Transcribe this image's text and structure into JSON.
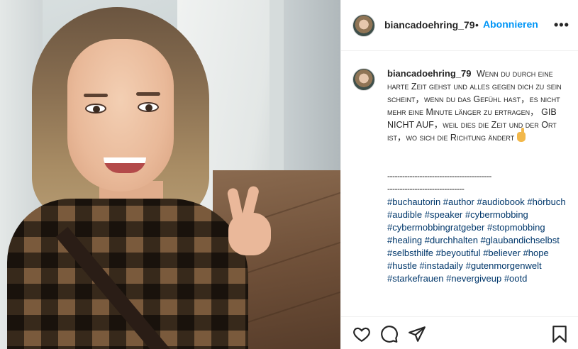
{
  "post": {
    "author": "biancadoehring_79",
    "follow_label": "Abonnieren",
    "separator": "•",
    "more_label": "•••",
    "photo_alt": "selfie"
  },
  "caption": {
    "author": "biancadoehring_79",
    "line1": "Wenn du durch eine harte Zeit gehst und alles gegen dich zu sein scheint，wenn du das Gefühl hast，es nicht mehr eine Minute länger zu ertragen，",
    "line2": "GIB NICHT AUF",
    "line3": "，weil dies die Zeit und der Ort ist，wo sich die Richtung ändert",
    "dashes1": "------------------------------------------",
    "dashes2": "-------------------------------",
    "hashtags": [
      "#buchautorin",
      "#author",
      "#audiobook",
      "#hörbuch",
      "#audible",
      "#speaker",
      "#cybermobbing",
      "#cybermobbingratgeber",
      "#stopmobbing",
      "#healing",
      "#durchhalten",
      "#glaubandichselbst",
      "#selbsthilfe",
      "#beyoutiful",
      "#believer",
      "#hope",
      "#hustle",
      "#instadaily",
      "#gutenmorgenwelt",
      "#starkefrauen",
      "#nevergiveup",
      "#ootd"
    ]
  },
  "actions": {
    "icons": [
      "heart-icon",
      "comment-icon",
      "share-icon",
      "bookmark-icon"
    ]
  }
}
